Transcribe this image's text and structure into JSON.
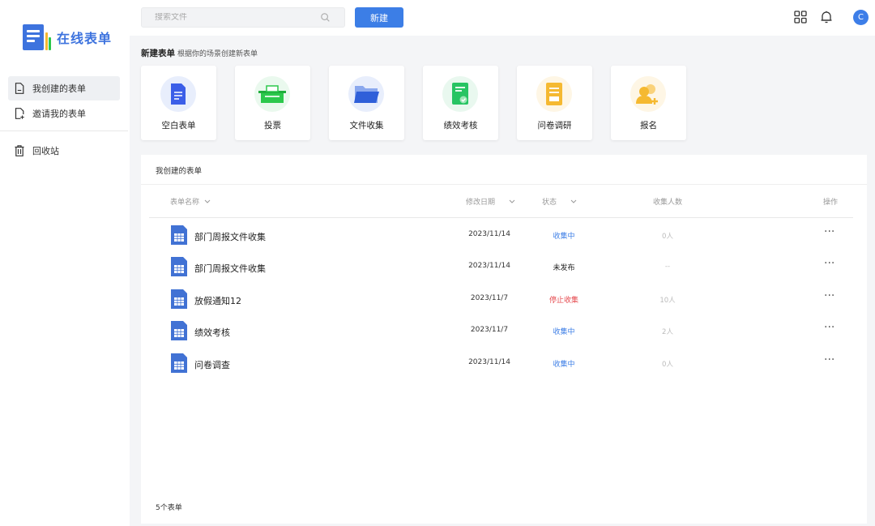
{
  "app": {
    "logo_text": "在线表单",
    "brand_color": "#3d73de"
  },
  "sidebar": {
    "items": [
      {
        "label": "我创建的表单",
        "icon": "document-icon",
        "active": true
      },
      {
        "label": "邀请我的表单",
        "icon": "document-add-icon",
        "active": false
      },
      {
        "label": "回收站",
        "icon": "trash-icon",
        "active": false
      }
    ]
  },
  "topbar": {
    "search_placeholder": "搜索文件",
    "new_button": "新建",
    "avatar_letter": "C",
    "icons": [
      "apps-grid-icon",
      "bell-icon"
    ]
  },
  "create": {
    "title": "新建表单",
    "subtitle": "根据你的场景创建新表单",
    "templates": [
      {
        "label": "空白表单",
        "icon": "blank-form-icon",
        "color": "#3b5ee8"
      },
      {
        "label": "投票",
        "icon": "vote-box-icon",
        "color": "#2cc84c"
      },
      {
        "label": "文件收集",
        "icon": "folder-icon",
        "color": "#2f5fd9"
      },
      {
        "label": "绩效考核",
        "icon": "clipboard-check-icon",
        "color": "#27c463"
      },
      {
        "label": "问卷调研",
        "icon": "survey-icon",
        "color": "#f5b931"
      },
      {
        "label": "报名",
        "icon": "signup-users-icon",
        "color": "#f5b931"
      }
    ]
  },
  "list": {
    "panel_title": "我创建的表单",
    "columns": {
      "name": "表单名称",
      "date": "修改日期",
      "status": "状态",
      "count": "收集人数",
      "actions": "操作"
    },
    "rows": [
      {
        "name": "部门周报文件收集",
        "date": "2023/11/14",
        "status": "收集中",
        "status_color": "#3c7ee6",
        "count": "0人"
      },
      {
        "name": "部门周报文件收集",
        "date": "2023/11/14",
        "status": "未发布",
        "status_color": "#222222",
        "count": "--"
      },
      {
        "name": "放假通知12",
        "date": "2023/11/7",
        "status": "停止收集",
        "status_color": "#e5484d",
        "count": "10人"
      },
      {
        "name": "绩效考核",
        "date": "2023/11/7",
        "status": "收集中",
        "status_color": "#3c7ee6",
        "count": "2人"
      },
      {
        "name": "问卷调查",
        "date": "2023/11/14",
        "status": "收集中",
        "status_color": "#3c7ee6",
        "count": "0人"
      }
    ],
    "more_label": "···",
    "total_text": "5个表单"
  }
}
